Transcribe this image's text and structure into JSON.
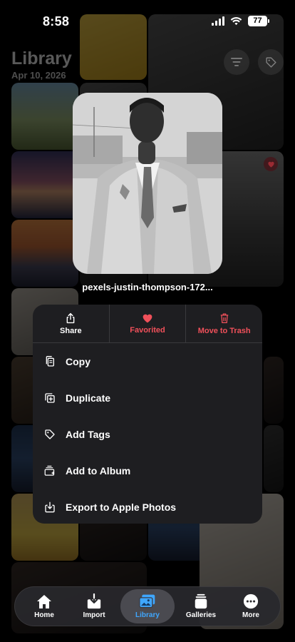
{
  "status": {
    "time": "8:58",
    "battery": "77"
  },
  "library": {
    "title": "Library",
    "date": "Apr 10, 2026"
  },
  "header_buttons": [
    "filter-icon",
    "tag-icon"
  ],
  "preview": {
    "caption": "pexels-justin-thompson-172..."
  },
  "quick_actions": [
    {
      "label": "Share",
      "icon": "share-icon"
    },
    {
      "label": "Favorited",
      "icon": "heart-icon",
      "color": "#f0505a"
    },
    {
      "label": "Move to Trash",
      "icon": "trash-icon",
      "color": "#f0505a"
    }
  ],
  "menu_items": [
    {
      "label": "Copy",
      "icon": "copy-icon"
    },
    {
      "label": "Duplicate",
      "icon": "duplicate-icon"
    },
    {
      "label": "Add Tags",
      "icon": "tag-icon"
    },
    {
      "label": "Add to Album",
      "icon": "album-icon"
    },
    {
      "label": "Export to Apple Photos",
      "icon": "export-icon"
    }
  ],
  "tabs": [
    {
      "label": "Home",
      "icon": "home-icon"
    },
    {
      "label": "Import",
      "icon": "import-icon"
    },
    {
      "label": "Library",
      "icon": "library-icon",
      "active": true
    },
    {
      "label": "Galleries",
      "icon": "galleries-icon"
    },
    {
      "label": "More",
      "icon": "more-icon"
    }
  ],
  "colors": {
    "accent": "#3fa7ff",
    "destructive": "#f0505a",
    "menu_bg": "#1e1e21"
  }
}
